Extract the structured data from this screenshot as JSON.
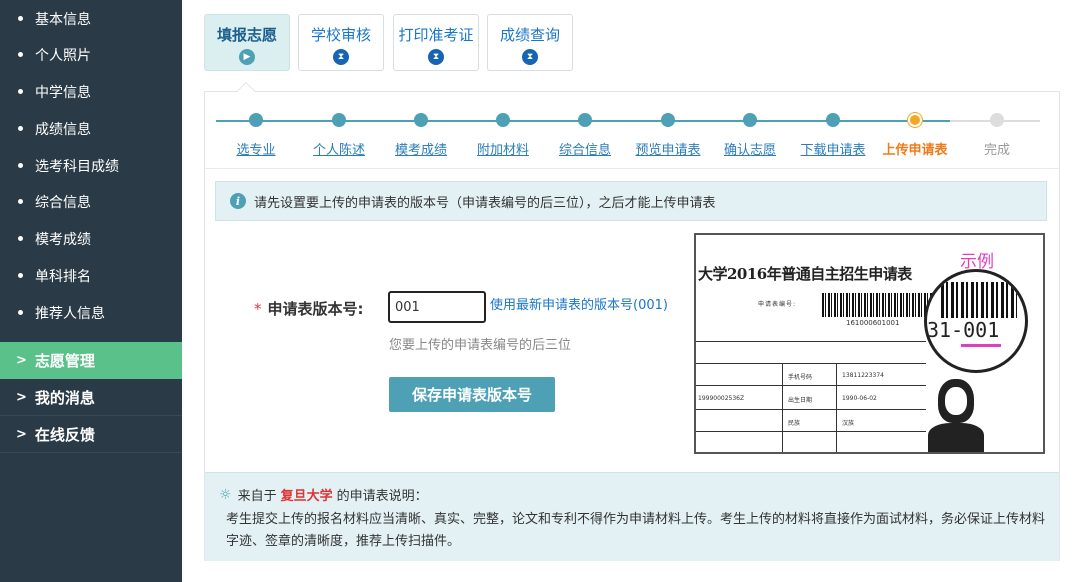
{
  "sidebar": {
    "sub_items": [
      "基本信息",
      "个人照片",
      "中学信息",
      "成绩信息",
      "选考科目成绩",
      "综合信息",
      "模考成绩",
      "单科排名",
      "推荐人信息"
    ],
    "main_items": [
      {
        "label": "志愿管理",
        "active": true
      },
      {
        "label": "我的消息",
        "active": false
      },
      {
        "label": "在线反馈",
        "active": false
      }
    ],
    "active_color": "#5bc18a",
    "bg_color": "#2a3b47"
  },
  "tabs": [
    {
      "label": "填报志愿",
      "icon": "play-icon",
      "active": true
    },
    {
      "label": "学校审核",
      "icon": "hourglass-icon",
      "active": false
    },
    {
      "label": "打印准考证",
      "icon": "hourglass-icon",
      "active": false
    },
    {
      "label": "成绩查询",
      "icon": "hourglass-icon",
      "active": false
    }
  ],
  "steps": [
    {
      "label": "选专业",
      "state": "done"
    },
    {
      "label": "个人陈述",
      "state": "done"
    },
    {
      "label": "模考成绩",
      "state": "done"
    },
    {
      "label": "附加材料",
      "state": "done"
    },
    {
      "label": "综合信息",
      "state": "done"
    },
    {
      "label": "预览申请表",
      "state": "done"
    },
    {
      "label": "确认志愿",
      "state": "done"
    },
    {
      "label": "下载申请表",
      "state": "done"
    },
    {
      "label": "上传申请表",
      "state": "current"
    },
    {
      "label": "完成",
      "state": "todo"
    }
  ],
  "notice": {
    "icon": "info-icon",
    "text": "请先设置要上传的申请表的版本号（申请表编号的后三位），之后才能上传申请表"
  },
  "form": {
    "required_mark": "*",
    "label": "申请表版本号:",
    "input_value": "001",
    "use_latest_link": "使用最新申请表的版本号(001)",
    "hint": "您要上传的申请表编号的后三位",
    "save_button": "保存申请表版本号"
  },
  "example": {
    "badge": "示例",
    "title": "大学2016年普通自主招生申请表",
    "field_label": "申请表编号:",
    "barcode_number": "161000601001",
    "magnified_code": "31-001",
    "table_cells": [
      "手机号码",
      "13811223374",
      "19990002536Z",
      "出生日期",
      "1990-06-02",
      "民族",
      "汉族"
    ]
  },
  "note": {
    "icon": "lightbulb-icon",
    "prefix": "来自于",
    "school": "复旦大学",
    "suffix": "的申请表说明：",
    "body": "考生提交上传的报名材料应当清晰、真实、完整，论文和专利不得作为申请材料上传。考生上传的材料将直接作为面试材料，务必保证上传材料字迹、签章的清晰度，推荐上传扫描件。"
  },
  "colors": {
    "accent": "#4ea1b5",
    "current_step": "#f07a1a",
    "link": "#1976c8",
    "school_name": "#dd3333"
  }
}
